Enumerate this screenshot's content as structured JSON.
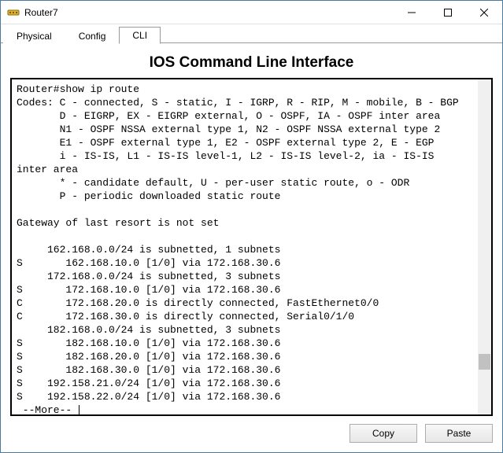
{
  "window": {
    "title": "Router7"
  },
  "tabs": {
    "physical": "Physical",
    "config": "Config",
    "cli": "CLI",
    "active": "cli"
  },
  "panel": {
    "title": "IOS Command Line Interface"
  },
  "terminal": {
    "prompt_line": "Router#show ip route",
    "codes_header": "Codes: C - connected, S - static, I - IGRP, R - RIP, M - mobile, B - BGP",
    "codes_l2": "       D - EIGRP, EX - EIGRP external, O - OSPF, IA - OSPF inter area",
    "codes_l3": "       N1 - OSPF NSSA external type 1, N2 - OSPF NSSA external type 2",
    "codes_l4": "       E1 - OSPF external type 1, E2 - OSPF external type 2, E - EGP",
    "codes_l5": "       i - IS-IS, L1 - IS-IS level-1, L2 - IS-IS level-2, ia - IS-IS",
    "codes_l5b": "inter area",
    "codes_l6": "       * - candidate default, U - per-user static route, o - ODR",
    "codes_l7": "       P - periodic downloaded static route",
    "blank": "",
    "gateway": "Gateway of last resort is not set",
    "r01": "     162.168.0.0/24 is subnetted, 1 subnets",
    "r02": "S       162.168.10.0 [1/0] via 172.168.30.6",
    "r03": "     172.168.0.0/24 is subnetted, 3 subnets",
    "r04": "S       172.168.10.0 [1/0] via 172.168.30.6",
    "r05": "C       172.168.20.0 is directly connected, FastEthernet0/0",
    "r06": "C       172.168.30.0 is directly connected, Serial0/1/0",
    "r07": "     182.168.0.0/24 is subnetted, 3 subnets",
    "r08": "S       182.168.10.0 [1/0] via 172.168.30.6",
    "r09": "S       182.168.20.0 [1/0] via 172.168.30.6",
    "r10": "S       182.168.30.0 [1/0] via 172.168.30.6",
    "r11": "S    192.158.21.0/24 [1/0] via 172.168.30.6",
    "r12": "S    192.158.22.0/24 [1/0] via 172.168.30.6",
    "more": " --More-- "
  },
  "buttons": {
    "copy": "Copy",
    "paste": "Paste"
  }
}
